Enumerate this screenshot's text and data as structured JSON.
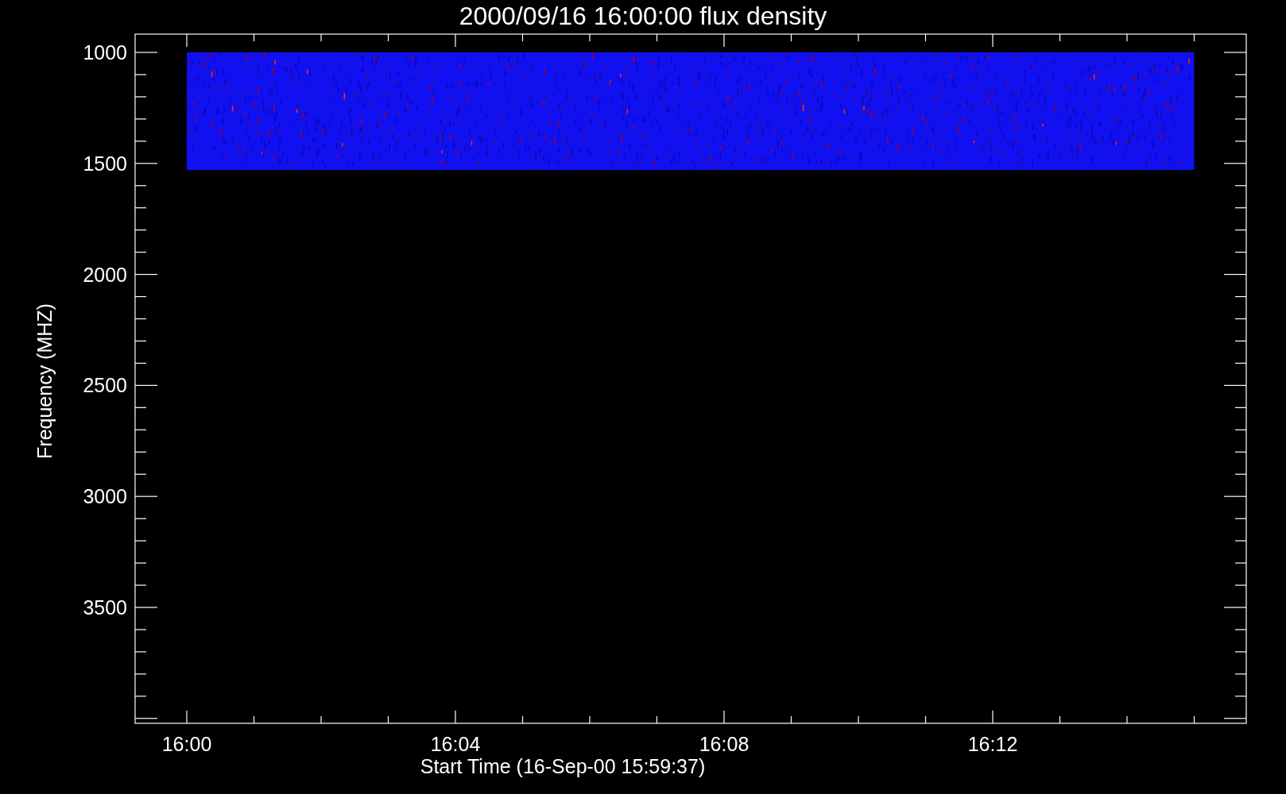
{
  "title": "2000/09/16 16:00:00 flux density",
  "ylabel": "Frequency (MHZ)",
  "xlabel": "Start Time (16-Sep-00 15:59:37)",
  "y_tick_labels": [
    "1000",
    "1500",
    "2000",
    "2500",
    "3000",
    "3500"
  ],
  "x_tick_labels": [
    "16:00",
    "16:04",
    "16:08",
    "16:12"
  ]
}
